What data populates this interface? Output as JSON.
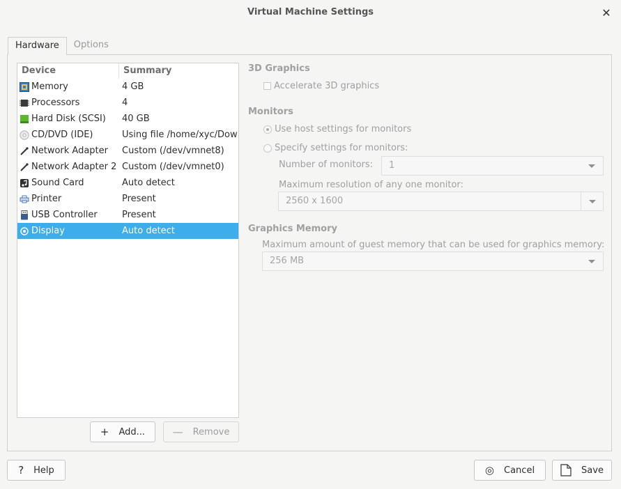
{
  "window": {
    "title": "Virtual Machine Settings",
    "close_glyph": "✕"
  },
  "tabs": [
    {
      "label": "Hardware",
      "active": true
    },
    {
      "label": "Options",
      "active": false
    }
  ],
  "device_list": {
    "headers": {
      "device": "Device",
      "summary": "Summary"
    },
    "rows": [
      {
        "device": "Memory",
        "summary": "4 GB",
        "icon": "memory-icon",
        "selected": false
      },
      {
        "device": "Processors",
        "summary": "4",
        "icon": "processor-icon",
        "selected": false
      },
      {
        "device": "Hard Disk (SCSI)",
        "summary": "40 GB",
        "icon": "hard-disk-icon",
        "selected": false
      },
      {
        "device": "CD/DVD (IDE)",
        "summary": "Using file /home/xyc/Dow",
        "icon": "cd-dvd-icon",
        "selected": false
      },
      {
        "device": "Network Adapter",
        "summary": "Custom (/dev/vmnet8)",
        "icon": "network-adapter-icon",
        "selected": false
      },
      {
        "device": "Network Adapter 2",
        "summary": "Custom (/dev/vmnet0)",
        "icon": "network-adapter-icon",
        "selected": false
      },
      {
        "device": "Sound Card",
        "summary": "Auto detect",
        "icon": "sound-card-icon",
        "selected": false
      },
      {
        "device": "Printer",
        "summary": "Present",
        "icon": "printer-icon",
        "selected": false
      },
      {
        "device": "USB Controller",
        "summary": "Present",
        "icon": "usb-icon",
        "selected": true,
        "selected_visual": false
      },
      {
        "device": "Display",
        "summary": "Auto detect",
        "icon": "display-icon",
        "selected": true
      }
    ]
  },
  "list_buttons": {
    "add_label": "Add...",
    "add_glyph": "+",
    "remove_label": "Remove",
    "remove_glyph": "—"
  },
  "settings": {
    "graphics3d": {
      "title": "3D Graphics",
      "accelerate_label": "Accelerate 3D graphics",
      "accelerate_checked": false
    },
    "monitors": {
      "title": "Monitors",
      "use_host_label": "Use host settings for monitors",
      "specify_label": "Specify settings for monitors:",
      "selected": "use_host",
      "number_label": "Number of monitors:",
      "number_value": "1",
      "resolution_label": "Maximum resolution of any one monitor:",
      "resolution_value": "2560 x 1600"
    },
    "graphics_memory": {
      "title": "Graphics Memory",
      "max_label": "Maximum amount of guest memory that can be used for graphics memory:",
      "max_value": "256 MB"
    }
  },
  "footer": {
    "help_label": "Help",
    "help_glyph": "?",
    "cancel_label": "Cancel",
    "cancel_glyph": "◎",
    "save_label": "Save"
  },
  "colors": {
    "selection": "#3daee9",
    "background": "#f5f5f4",
    "disabled_text": "#a0a0a0"
  }
}
